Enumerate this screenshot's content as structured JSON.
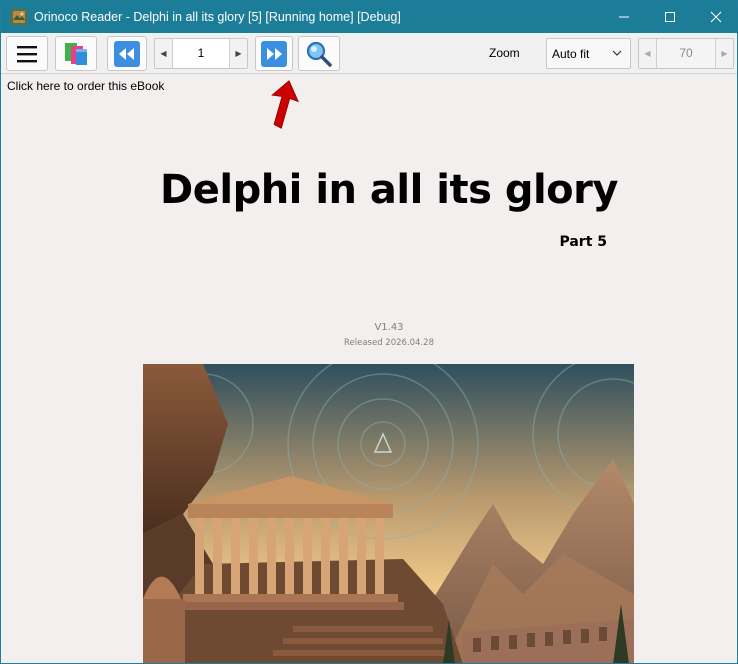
{
  "window": {
    "title": "Orinoco Reader - Delphi in all its glory [5] [Running home] [Debug]",
    "titlebar_color": "#1c7d99"
  },
  "toolbar": {
    "menu_icon": "hamburger-menu-icon",
    "library_icon": "books-icon",
    "prev_icon": "rewind-icon",
    "next_icon": "fast-forward-icon",
    "search_icon": "magnifier-icon",
    "page_number": "1",
    "zoom_label": "Zoom",
    "zoom_mode": "Auto fit",
    "zoom_value": "70"
  },
  "content": {
    "order_link": "Click here to order this eBook",
    "book_title": "Delphi in all its glory",
    "part": "Part 5",
    "version": "V1.43",
    "released": "Released 2026.04.28",
    "cover_icon": "greek-temple-cover-illustration"
  },
  "annotation": {
    "arrow_icon": "red-arrow-pointer-icon",
    "arrow_color": "#cc0000"
  }
}
